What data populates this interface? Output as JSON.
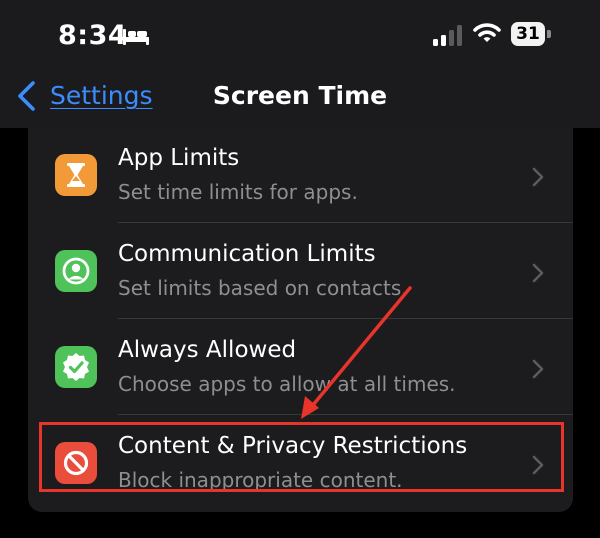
{
  "status_bar": {
    "time": "8:34",
    "battery": "31",
    "icons": [
      "bed-icon",
      "signal-icon",
      "wifi-icon",
      "battery-icon"
    ]
  },
  "nav": {
    "back_label": "Settings",
    "title": "Screen Time"
  },
  "rows": [
    {
      "title": "App Limits",
      "subtitle": "Set time limits for apps.",
      "icon": "hourglass-icon",
      "icon_color": "#f19a37"
    },
    {
      "title": "Communication Limits",
      "subtitle": "Set limits based on contacts.",
      "icon": "person-circle-icon",
      "icon_color": "#4fc25a"
    },
    {
      "title": "Always Allowed",
      "subtitle": "Choose apps to allow at all times.",
      "icon": "checkmark-seal-icon",
      "icon_color": "#4fc25a"
    },
    {
      "title": "Content & Privacy Restrictions",
      "subtitle": "Block inappropriate content.",
      "icon": "no-entry-icon",
      "icon_color": "#eb4d3d"
    }
  ],
  "annotation": {
    "color": "#e8342a",
    "highlighted_row": "Content & Privacy Restrictions"
  },
  "colors": {
    "link_blue": "#3b8cff",
    "secondary_text": "#8e8e93",
    "cell_background": "#1c1c1e"
  }
}
